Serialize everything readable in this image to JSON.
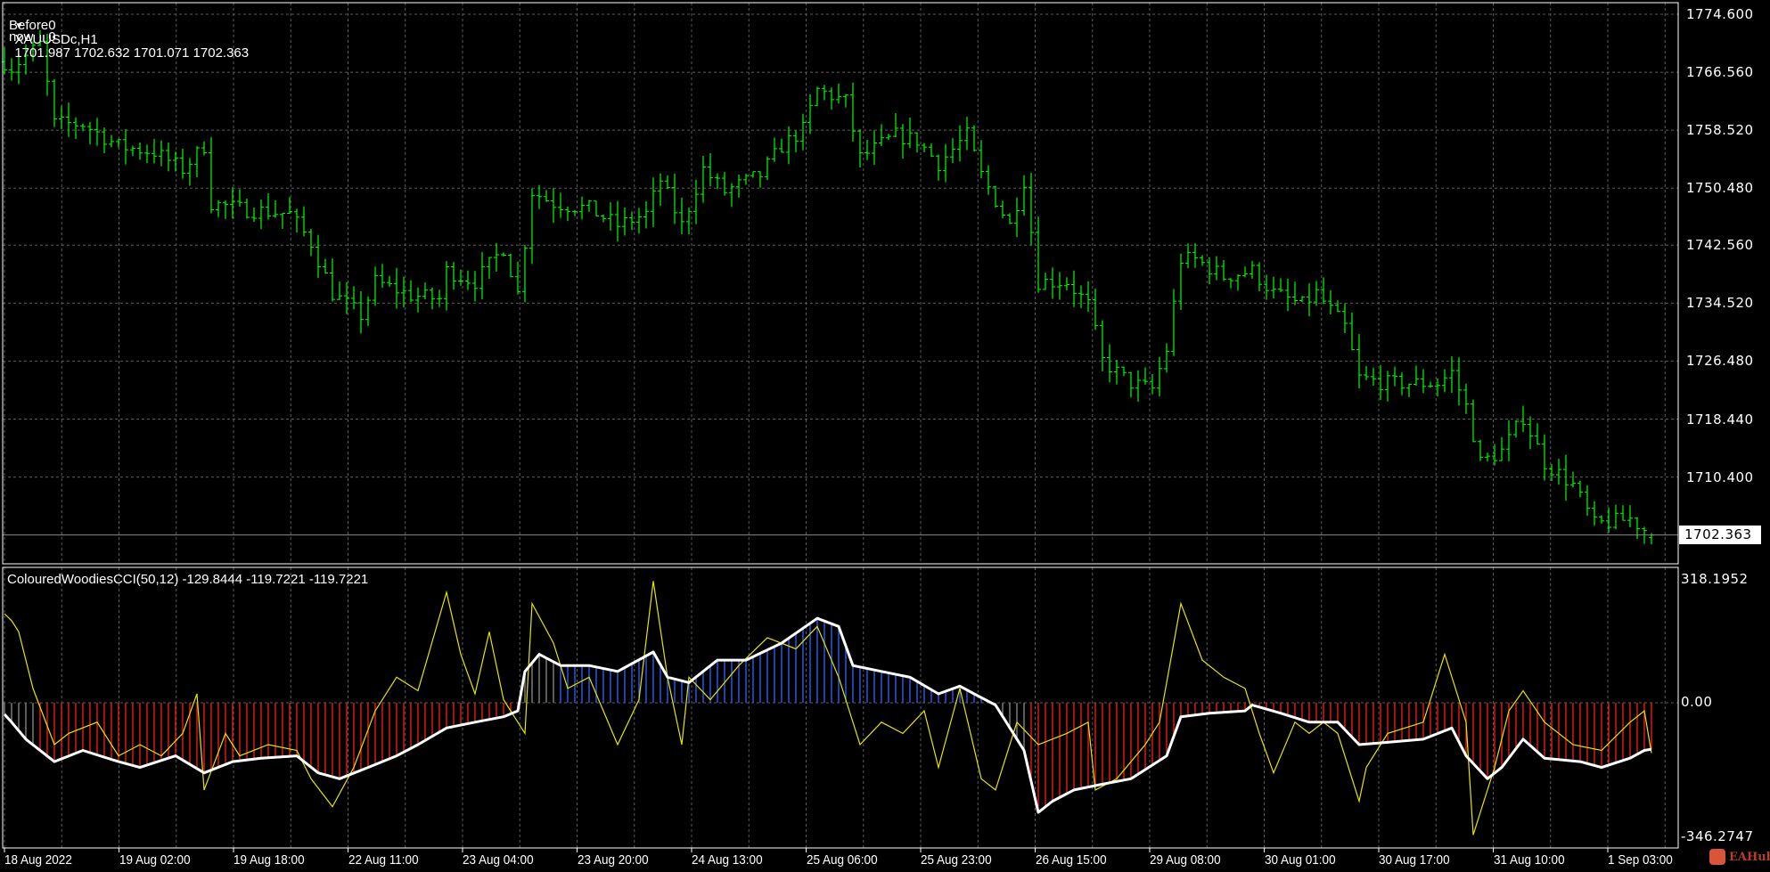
{
  "header": {
    "symbol": "XAUUSDc,H1",
    "ohlc": "1701.987 1702.632 1701.071 1702.363",
    "line2": "Before0",
    "line3_label": "now",
    "line3_value": "0"
  },
  "indicator": {
    "label": "ColouredWoodiesCCI(50,12) -129.8444 -119.7221 -119.7221"
  },
  "price_axis": [
    "1774.600",
    "1766.560",
    "1758.520",
    "1750.480",
    "1742.560",
    "1734.520",
    "1726.480",
    "1718.440",
    "1710.400"
  ],
  "current_price": "1702.363",
  "indicator_axis": [
    "318.1952",
    "0.00",
    "-346.2747"
  ],
  "time_axis": [
    "18 Aug 2022",
    "19 Aug 02:00",
    "19 Aug 18:00",
    "22 Aug 11:00",
    "23 Aug 04:00",
    "23 Aug 20:00",
    "24 Aug 13:00",
    "25 Aug 06:00",
    "25 Aug 23:00",
    "26 Aug 15:00",
    "29 Aug 08:00",
    "30 Aug 01:00",
    "30 Aug 17:00",
    "31 Aug 10:00",
    "1 Sep 03:00"
  ],
  "watermark": "EAHub",
  "colors": {
    "bull": "#00ff00",
    "grid": "#5c5c5c",
    "cci_fast": "#e6e600",
    "cci_slow": "#ffffff",
    "hist_up": "#3a5cff",
    "hist_down": "#ff1a1a",
    "hist_neutral": "#8c8c8c"
  },
  "chart_data": [
    {
      "type": "line",
      "title": "XAUUSDc,H1",
      "note": "close keypoints [bar_index, price]; OHLC bars interpolated",
      "ylim": [
        1698.5,
        1776.5
      ],
      "last_ohlc": [
        1701.987,
        1702.632,
        1701.071,
        1702.363
      ],
      "bars": 232,
      "close_keypoints": [
        [
          0,
          1768
        ],
        [
          1,
          1767.2
        ],
        [
          5,
          1770.4
        ],
        [
          7,
          1759.4
        ],
        [
          11,
          1759.4
        ],
        [
          16,
          1756.3
        ],
        [
          21,
          1755.5
        ],
        [
          25,
          1753.1
        ],
        [
          28,
          1756.3
        ],
        [
          29,
          1748.4
        ],
        [
          33,
          1747.6
        ],
        [
          40,
          1746.9
        ],
        [
          43,
          1742.9
        ],
        [
          46,
          1735.9
        ],
        [
          50,
          1732.8
        ],
        [
          52,
          1737.5
        ],
        [
          57,
          1735.6
        ],
        [
          61,
          1735.1
        ],
        [
          62,
          1739.0
        ],
        [
          66,
          1737.5
        ],
        [
          70,
          1742.2
        ],
        [
          72,
          1735.9
        ],
        [
          74,
          1750.0
        ],
        [
          77,
          1748.4
        ],
        [
          82,
          1747.6
        ],
        [
          86,
          1745.3
        ],
        [
          90,
          1746.9
        ],
        [
          92,
          1751.6
        ],
        [
          95,
          1745.3
        ],
        [
          98,
          1753.1
        ],
        [
          101,
          1750.0
        ],
        [
          106,
          1752.3
        ],
        [
          109,
          1756.3
        ],
        [
          112,
          1758.6
        ],
        [
          114,
          1764.1
        ],
        [
          118,
          1762.5
        ],
        [
          120,
          1754.7
        ],
        [
          125,
          1757.8
        ],
        [
          128,
          1757.1
        ],
        [
          131,
          1753.9
        ],
        [
          135,
          1757.8
        ],
        [
          137,
          1752.3
        ],
        [
          141,
          1745.3
        ],
        [
          143,
          1751.6
        ],
        [
          145,
          1737.5
        ],
        [
          149,
          1737.5
        ],
        [
          152,
          1734.3
        ],
        [
          154,
          1726.5
        ],
        [
          158,
          1723.4
        ],
        [
          161,
          1722.6
        ],
        [
          163,
          1728.1
        ],
        [
          165,
          1740.6
        ],
        [
          167,
          1740.6
        ],
        [
          171,
          1738.2
        ],
        [
          175,
          1739.0
        ],
        [
          178,
          1735.9
        ],
        [
          182,
          1734.3
        ],
        [
          184,
          1735.9
        ],
        [
          188,
          1731.2
        ],
        [
          190,
          1724.1
        ],
        [
          194,
          1723.4
        ],
        [
          201,
          1723.4
        ],
        [
          203,
          1724.9
        ],
        [
          205,
          1720.2
        ],
        [
          207,
          1712.4
        ],
        [
          210,
          1714.0
        ],
        [
          213,
          1718.7
        ],
        [
          216,
          1712.4
        ],
        [
          220,
          1709.3
        ],
        [
          223,
          1703.8
        ],
        [
          228,
          1704.6
        ],
        [
          231,
          1702.363
        ]
      ]
    },
    {
      "type": "line",
      "title": "ColouredWoodiesCCI(50,12)",
      "ylim": [
        -346.2747,
        318.1952
      ],
      "series": [
        {
          "name": "CCI slow",
          "points": [
            [
              0,
              -30
            ],
            [
              1,
              -50
            ],
            [
              3,
              -94
            ],
            [
              7,
              -152
            ],
            [
              11,
              -123
            ],
            [
              16,
              -152
            ],
            [
              19,
              -167
            ],
            [
              24,
              -137
            ],
            [
              28,
              -181
            ],
            [
              32,
              -152
            ],
            [
              36,
              -143
            ],
            [
              41,
              -137
            ],
            [
              44,
              -181
            ],
            [
              47,
              -196
            ],
            [
              51,
              -167
            ],
            [
              55,
              -137
            ],
            [
              58,
              -108
            ],
            [
              62,
              -65
            ],
            [
              66,
              -50
            ],
            [
              70,
              -36
            ],
            [
              72,
              -21
            ],
            [
              73,
              81
            ],
            [
              75,
              125
            ],
            [
              78,
              96
            ],
            [
              82,
              96
            ],
            [
              86,
              81
            ],
            [
              91,
              131
            ],
            [
              93,
              66
            ],
            [
              96,
              52
            ],
            [
              100,
              110
            ],
            [
              104,
              110
            ],
            [
              109,
              154
            ],
            [
              114,
              218
            ],
            [
              117,
              197
            ],
            [
              119,
              96
            ],
            [
              123,
              81
            ],
            [
              127,
              66
            ],
            [
              131,
              23
            ],
            [
              134,
              43
            ],
            [
              136,
              23
            ],
            [
              139,
              -6
            ],
            [
              143,
              -123
            ],
            [
              145,
              -283
            ],
            [
              147,
              -254
            ],
            [
              150,
              -225
            ],
            [
              154,
              -210
            ],
            [
              158,
              -196
            ],
            [
              163,
              -137
            ],
            [
              165,
              -36
            ],
            [
              169,
              -27
            ],
            [
              174,
              -21
            ],
            [
              175,
              -6
            ],
            [
              179,
              -27
            ],
            [
              183,
              -50
            ],
            [
              187,
              -50
            ],
            [
              190,
              -108
            ],
            [
              194,
              -102
            ],
            [
              199,
              -94
            ],
            [
              203,
              -65
            ],
            [
              205,
              -137
            ],
            [
              208,
              -196
            ],
            [
              210,
              -167
            ],
            [
              213,
              -94
            ],
            [
              216,
              -143
            ],
            [
              221,
              -152
            ],
            [
              224,
              -167
            ],
            [
              228,
              -143
            ],
            [
              230,
              -123
            ],
            [
              231,
              -119.7221
            ]
          ]
        },
        {
          "name": "CCI fast",
          "points": [
            [
              0,
              230
            ],
            [
              1,
              212
            ],
            [
              2,
              183
            ],
            [
              4,
              37
            ],
            [
              7,
              -108
            ],
            [
              9,
              -79
            ],
            [
              13,
              -50
            ],
            [
              16,
              -137
            ],
            [
              19,
              -108
            ],
            [
              22,
              -137
            ],
            [
              25,
              -79
            ],
            [
              27,
              23
            ],
            [
              28,
              -225
            ],
            [
              31,
              -79
            ],
            [
              33,
              -137
            ],
            [
              37,
              -108
            ],
            [
              41,
              -123
            ],
            [
              43,
              -196
            ],
            [
              46,
              -268
            ],
            [
              49,
              -167
            ],
            [
              52,
              -21
            ],
            [
              55,
              66
            ],
            [
              58,
              31
            ],
            [
              62,
              285
            ],
            [
              64,
              125
            ],
            [
              66,
              23
            ],
            [
              68,
              183
            ],
            [
              70,
              8
            ],
            [
              73,
              -79
            ],
            [
              74,
              256
            ],
            [
              77,
              154
            ],
            [
              79,
              37
            ],
            [
              82,
              66
            ],
            [
              86,
              -108
            ],
            [
              89,
              8
            ],
            [
              91,
              314
            ],
            [
              93,
              66
            ],
            [
              95,
              -108
            ],
            [
              96,
              66
            ],
            [
              99,
              8
            ],
            [
              103,
              96
            ],
            [
              107,
              168
            ],
            [
              111,
              139
            ],
            [
              114,
              197
            ],
            [
              117,
              66
            ],
            [
              120,
              -108
            ],
            [
              123,
              -50
            ],
            [
              126,
              -79
            ],
            [
              129,
              -21
            ],
            [
              131,
              -167
            ],
            [
              134,
              37
            ],
            [
              137,
              -196
            ],
            [
              139,
              -225
            ],
            [
              142,
              -50
            ],
            [
              145,
              -108
            ],
            [
              149,
              -79
            ],
            [
              152,
              -50
            ],
            [
              153,
              -225
            ],
            [
              156,
              -196
            ],
            [
              160,
              -108
            ],
            [
              162,
              -50
            ],
            [
              164,
              154
            ],
            [
              165,
              256
            ],
            [
              168,
              110
            ],
            [
              171,
              66
            ],
            [
              174,
              37
            ],
            [
              176,
              -79
            ],
            [
              178,
              -181
            ],
            [
              181,
              -50
            ],
            [
              183,
              -79
            ],
            [
              185,
              -50
            ],
            [
              187,
              -79
            ],
            [
              190,
              -254
            ],
            [
              191,
              -167
            ],
            [
              194,
              -79
            ],
            [
              199,
              -50
            ],
            [
              202,
              125
            ],
            [
              205,
              -50
            ],
            [
              206,
              -341
            ],
            [
              209,
              -167
            ],
            [
              211,
              -21
            ],
            [
              213,
              31
            ],
            [
              216,
              -50
            ],
            [
              220,
              -108
            ],
            [
              224,
              -123
            ],
            [
              228,
              -50
            ],
            [
              230,
              -21
            ],
            [
              231,
              -129.8444
            ]
          ]
        }
      ]
    }
  ]
}
